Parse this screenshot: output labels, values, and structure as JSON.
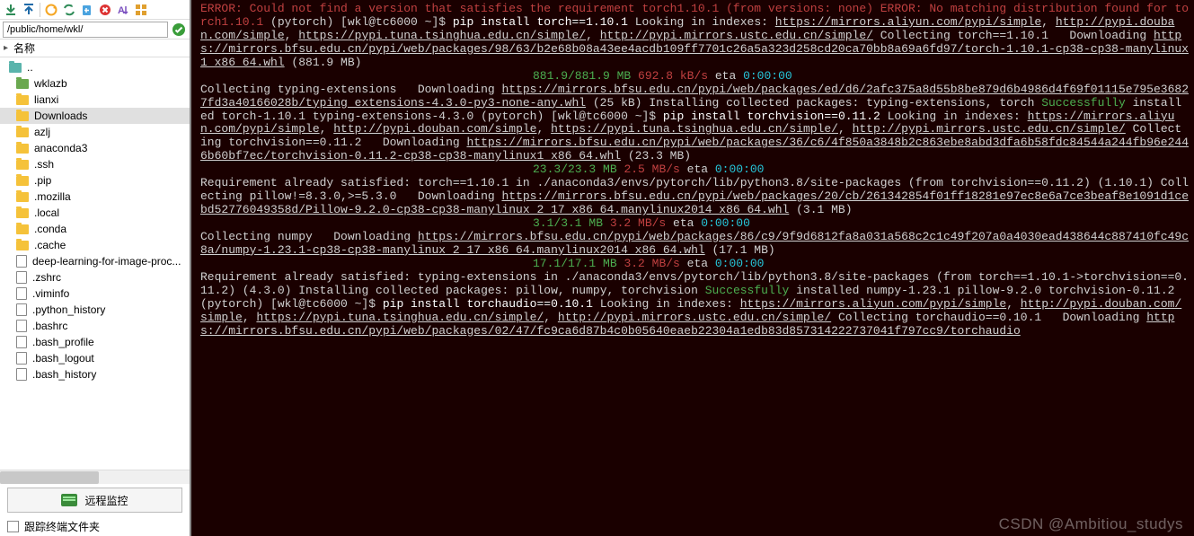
{
  "toolbar_icons": [
    "download",
    "upload",
    "divider",
    "refresh-circle",
    "refresh-arrows",
    "new-file",
    "cancel",
    "sort-asc",
    "grid-view"
  ],
  "path": "/public/home/wkl/",
  "header_label": "名称",
  "files": [
    {
      "name": "..",
      "type": "up"
    },
    {
      "name": "wklazb",
      "type": "folder-g"
    },
    {
      "name": "lianxi",
      "type": "folder"
    },
    {
      "name": "Downloads",
      "type": "folder",
      "selected": true
    },
    {
      "name": "azlj",
      "type": "folder"
    },
    {
      "name": "anaconda3",
      "type": "folder"
    },
    {
      "name": ".ssh",
      "type": "folder"
    },
    {
      "name": ".pip",
      "type": "folder"
    },
    {
      "name": ".mozilla",
      "type": "folder"
    },
    {
      "name": ".local",
      "type": "folder"
    },
    {
      "name": ".conda",
      "type": "folder"
    },
    {
      "name": ".cache",
      "type": "folder"
    },
    {
      "name": "deep-learning-for-image-proc...",
      "type": "doc"
    },
    {
      "name": ".zshrc",
      "type": "doc"
    },
    {
      "name": ".viminfo",
      "type": "doc"
    },
    {
      "name": ".python_history",
      "type": "doc"
    },
    {
      "name": ".bashrc",
      "type": "doc"
    },
    {
      "name": ".bash_profile",
      "type": "doc"
    },
    {
      "name": ".bash_logout",
      "type": "doc"
    },
    {
      "name": ".bash_history",
      "type": "doc"
    }
  ],
  "remote_label": "远程监控",
  "track_label": "跟踪终端文件夹",
  "watermark": "CSDN @Ambitiou_studys",
  "term": {
    "err1": "ERROR: Could not find a version that satisfies the requirement torch1.10.1 (from versions: none)",
    "err2": "ERROR: No matching distribution found for torch1.10.1",
    "prompt": "(pytorch) [wkl@tc6000 ~]$ ",
    "cmd_torch": "pip install torch==1.10.1",
    "cmd_tv": "pip install torchvision==0.11.2",
    "cmd_ta": "pip install torchaudio==0.10.1",
    "idx_a": "Looking in indexes: ",
    "idx_aliyun": "https://mirrors.aliyun.com/pypi/simple",
    "idx_douban": "http://pypi.douban.com/simple",
    "idx_tuna": "https://pypi.tuna.tsinghua.edu.cn/simple/",
    "idx_ustc": "http://pypi.mirrors.ustc.edu.cn/simple/",
    "col_torch": "Collecting torch==1.10.1",
    "dl": "  Downloading ",
    "url_torch": "https://mirrors.bfsu.edu.cn/pypi/web/packages/98/63/b2e68b08a43ee4acdb109ff7701c26a5a323d258cd20ca70bb8a69a6fd97/torch-1.10.1-cp38-cp38-manylinux1_x86_64.whl",
    "size_torch": " (881.9 MB)",
    "prog_torch_a": "881.9/881.9 MB",
    "prog_torch_b": "692.8 kB/s",
    "eta_lbl": " eta ",
    "eta_v": "0:00:00",
    "col_te": "Collecting typing-extensions",
    "url_te": "https://mirrors.bfsu.edu.cn/pypi/web/packages/ed/d6/2afc375a8d55b8be879d6b4986d4f69f01115e795e36827fd3a40166028b/typing_extensions-4.3.0-py3-none-any.whl",
    "size_te": " (25 kB)",
    "inst1": "Installing collected packages: typing-extensions, torch",
    "succ": "Successfully",
    "succ1": " installed torch-1.10.1 typing-extensions-4.3.0",
    "col_tv": "Collecting torchvision==0.11.2",
    "url_tv": "https://mirrors.bfsu.edu.cn/pypi/web/packages/36/c6/4f850a3848b2c863ebe8abd3dfa6b58fdc84544a244fb96e2446b60bf7ec/torchvision-0.11.2-cp38-cp38-manylinux1_x86_64.whl",
    "size_tv": " (23.3 MB)",
    "prog_tv_a": "23.3/23.3 MB",
    "prog_tv_b": "2.5 MB/s",
    "req_torch": "Requirement already satisfied: torch==1.10.1 in ./anaconda3/envs/pytorch/lib/python3.8/site-packages (from torchvision==0.11.2) (1.10.1)",
    "col_pil": "Collecting pillow!=8.3.0,>=5.3.0",
    "url_pil": "https://mirrors.bfsu.edu.cn/pypi/web/packages/20/cb/261342854f01ff18281e97ec8e6a7ce3beaf8e1091d1cebd52776049358d/Pillow-9.2.0-cp38-cp38-manylinux_2_17_x86_64.manylinux2014_x86_64.whl",
    "size_pil": " (3.1 MB)",
    "prog_pil_a": "3.1/3.1 MB",
    "prog_pil_b": "3.2 MB/s",
    "col_np": "Collecting numpy",
    "url_np": "https://mirrors.bfsu.edu.cn/pypi/web/packages/86/c9/9f9d6812fa8a031a568c2c1c49f207a0a4030ead438644c887410fc49c8a/numpy-1.23.1-cp38-cp38-manylinux_2_17_x86_64.manylinux2014_x86_64.whl",
    "size_np": " (17.1 MB)",
    "prog_np_a": "17.1/17.1 MB",
    "prog_np_b": "3.2 MB/s",
    "req_te": "Requirement already satisfied: typing-extensions in ./anaconda3/envs/pytorch/lib/python3.8/site-packages (from torch==1.10.1->torchvision==0.11.2) (4.3.0)",
    "inst2": "Installing collected packages: pillow, numpy, torchvision",
    "succ2": " installed numpy-1.23.1 pillow-9.2.0 torchvision-0.11.2",
    "col_ta": "Collecting torchaudio==0.10.1",
    "url_ta": "https://mirrors.bfsu.edu.cn/pypi/web/packages/02/47/fc9ca6d87b4c0b05640eaeb22304a1edb83d857314222737041f797cc9/torchaudio"
  }
}
